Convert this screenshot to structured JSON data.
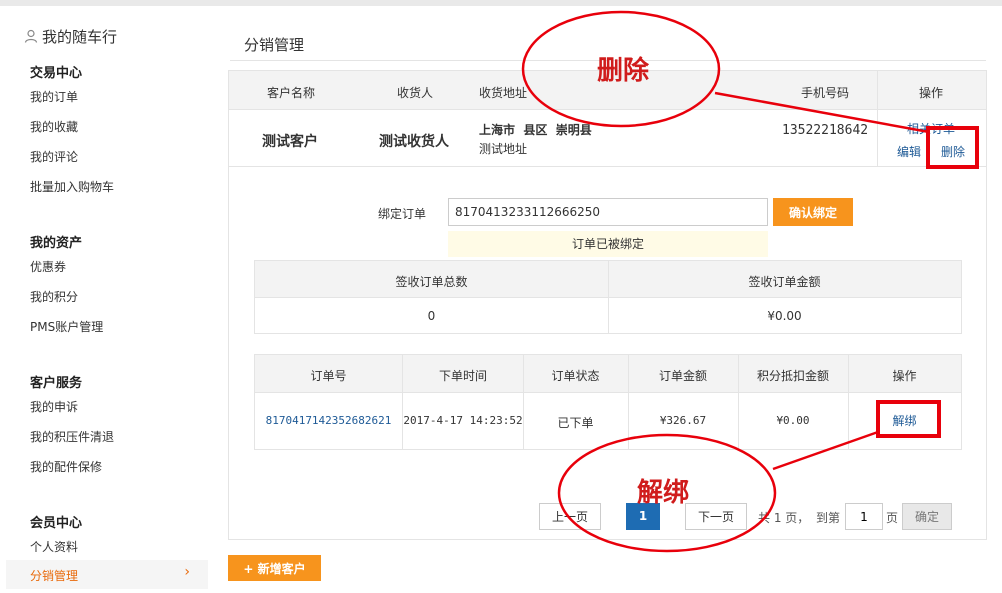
{
  "sidebar": {
    "title": "我的随车行",
    "sections": [
      {
        "heading": "交易中心",
        "items": [
          "我的订单",
          "我的收藏",
          "我的评论",
          "批量加入购物车"
        ]
      },
      {
        "heading": "我的资产",
        "items": [
          "优惠券",
          "我的积分",
          "PMS账户管理"
        ]
      },
      {
        "heading": "客户服务",
        "items": [
          "我的申诉",
          "我的积压件清退",
          "我的配件保修"
        ]
      },
      {
        "heading": "会员中心",
        "items": [
          "个人资料"
        ]
      }
    ],
    "active_item": "分销管理",
    "active_chevron": "›"
  },
  "page": {
    "title": "分销管理"
  },
  "customer_table": {
    "headers": [
      "客户名称",
      "收货人",
      "收货地址",
      "手机号码",
      "操作"
    ],
    "row": {
      "name": "测试客户",
      "receiver": "测试收货人",
      "address_region": "上海市  县区  崇明县",
      "address_detail": "测试地址",
      "phone": "13522218642",
      "action_related": "相关订单",
      "action_edit": "编辑",
      "action_delete": "删除"
    }
  },
  "bind": {
    "label": "绑定订单",
    "input_value": "8170413233112666250",
    "confirm_label": "确认绑定",
    "message": "订单已被绑定"
  },
  "summary": {
    "headers": [
      "签收订单总数",
      "签收订单金额"
    ],
    "values": [
      "0",
      "¥0.00"
    ]
  },
  "orders": {
    "headers": [
      "订单号",
      "下单时间",
      "订单状态",
      "订单金额",
      "积分抵扣金额",
      "操作"
    ],
    "rows": [
      {
        "order_no": "8170417142352682621",
        "time": "2017-4-17 14:23:52",
        "status": "已下单",
        "amount": "¥326.67",
        "points": "¥0.00",
        "action": "解绑"
      }
    ]
  },
  "pagination": {
    "prev": "上一页",
    "current": "1",
    "next": "下一页",
    "total_text": "共 1 页，",
    "goto_text": "到第",
    "goto_value": "1",
    "page_unit": "页",
    "ok": "确定"
  },
  "new_customer_button": "+ 新增客户",
  "annotations": {
    "delete_label": "删除",
    "unbind_label": "解绑",
    "color": "#e8000b"
  }
}
